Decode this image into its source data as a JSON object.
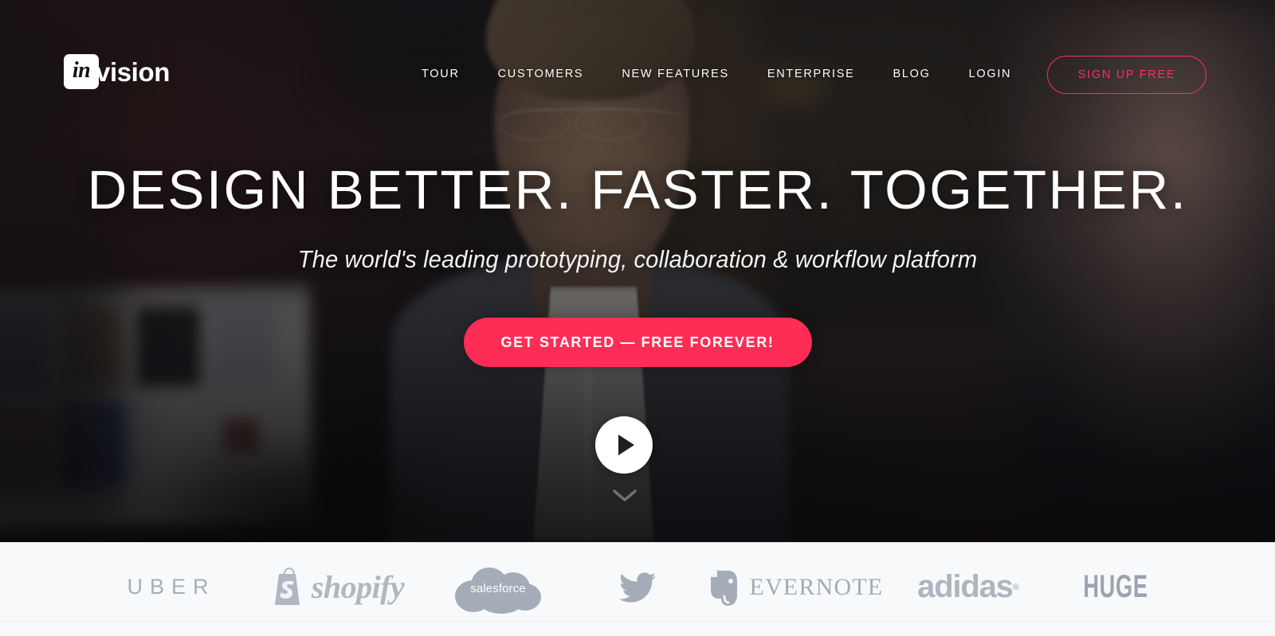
{
  "header": {
    "logo": {
      "mark": "in",
      "word": "vision",
      "name": "invision-logo"
    },
    "nav": [
      {
        "label": "TOUR",
        "name": "nav-tour"
      },
      {
        "label": "CUSTOMERS",
        "name": "nav-customers"
      },
      {
        "label": "NEW FEATURES",
        "name": "nav-new-features"
      },
      {
        "label": "ENTERPRISE",
        "name": "nav-enterprise"
      },
      {
        "label": "BLOG",
        "name": "nav-blog"
      },
      {
        "label": "LOGIN",
        "name": "nav-login"
      }
    ],
    "signup_label": "SIGN UP FREE"
  },
  "hero": {
    "headline": "DESIGN BETTER. FASTER. TOGETHER.",
    "subhead": "The world's leading prototyping, collaboration & workflow platform",
    "cta_label": "GET STARTED — FREE FOREVER!",
    "play_icon": "play-icon",
    "scroll_icon": "chevron-down-icon"
  },
  "logobar": {
    "brands": [
      {
        "name": "uber-logo",
        "text": "UBER"
      },
      {
        "name": "shopify-logo",
        "text": "shopify"
      },
      {
        "name": "salesforce-logo",
        "text": "salesforce"
      },
      {
        "name": "twitter-logo",
        "text": ""
      },
      {
        "name": "evernote-logo",
        "text": "EVERNOTE"
      },
      {
        "name": "adidas-logo",
        "text": "adidas",
        "mark": "®"
      },
      {
        "name": "huge-logo",
        "text": "HUGE"
      }
    ]
  },
  "colors": {
    "accent_pink": "#ff2d55",
    "accent_outline": "#ff2d64",
    "hero_bg": "#15161a",
    "logobar_bg": "#f8f9fa",
    "brand_gray": "#a3acb8"
  }
}
